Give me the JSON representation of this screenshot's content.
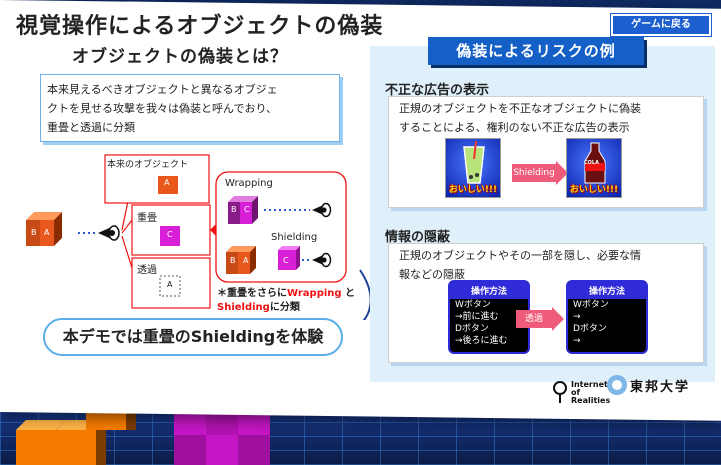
{
  "title": "視覚操作によるオブジェクトの偽装",
  "back_button": "ゲームに戻る",
  "subtitle": "オブジェクトの偽装とは？",
  "definition": {
    "line1": "本来見えるべきオブジェクトと異なるオブジェ",
    "line2": "クトを見せる攻撃を我々は偽装と呼んでおり、",
    "line3": "重畳と透過に分類"
  },
  "diagram": {
    "original_label": "本来のオブジェクト",
    "overlay_label": "重畳",
    "transparent_label": "透過",
    "wrapping_label": "Wrapping",
    "shielding_label": "Shielding",
    "cube_a": "A",
    "cube_b": "B",
    "cube_c": "C",
    "note_prefix": "＊重畳をさらに",
    "note_wrapping": "Wrapping",
    "note_and": " と",
    "note_shielding": "Shielding",
    "note_suffix": "に分類"
  },
  "demo_text": "本デモでは重畳のShieldingを体験",
  "risk": {
    "title": "偽装によるリスクの例",
    "ad": {
      "heading": "不正な広告の表示",
      "line1": "正規のオブジェクトを不正なオブジェクトに偽装",
      "line2": "することによる、権利のない不正な広告の表示",
      "arrow": "Shielding",
      "caption": "おいしい!!!",
      "cola": "COLA"
    },
    "hide": {
      "heading": "情報の隠蔽",
      "line1": "正規のオブジェクトやその一部を隠し、必要な情",
      "line2": "報などの隠蔽",
      "arrow": "透過",
      "op_title": "操作方法",
      "left_lines": [
        "Wボタン",
        "→前に進む",
        "Dボタン",
        "→後ろに進む"
      ],
      "right_lines": [
        "Wボタン",
        "→",
        "Dボタン",
        "→"
      ]
    }
  },
  "logos": {
    "ior_line1": "Internet",
    "ior_line2": "of",
    "ior_line3": "Realities",
    "university": "東邦大学"
  },
  "colors": {
    "accent_blue": "#1560c7",
    "shielding_red": "#e11111",
    "cube_orange": "#e8581c",
    "cube_magenta": "#d61fd6",
    "panel_light_blue": "#dff0fb"
  }
}
